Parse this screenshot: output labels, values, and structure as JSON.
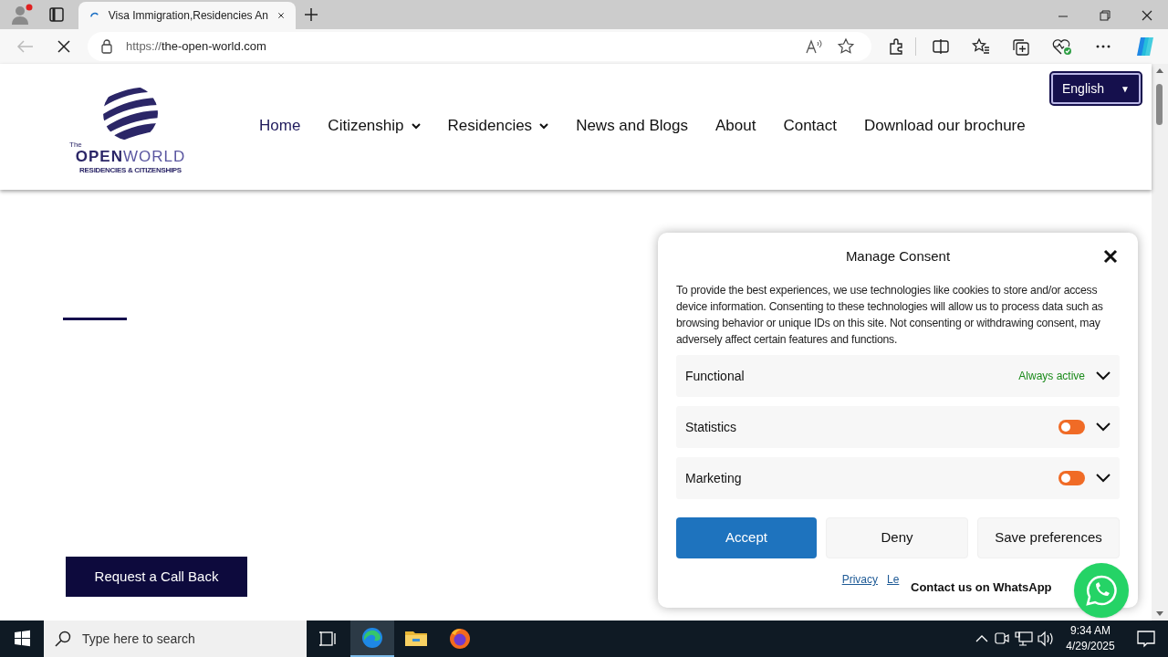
{
  "browser": {
    "tab": {
      "title": "Visa Immigration,Residencies An",
      "loading": true
    },
    "url_scheme": "https://",
    "url_host": "the-open-world.com"
  },
  "site": {
    "logo": {
      "small": "The",
      "name_bold": "OPEN",
      "name_light": "WORLD",
      "tagline": "RESIDENCIES & CITIZENSHIPS"
    },
    "nav": [
      {
        "label": "Home",
        "selected": true,
        "dropdown": false
      },
      {
        "label": "Citizenship",
        "selected": false,
        "dropdown": true
      },
      {
        "label": "Residencies",
        "selected": false,
        "dropdown": true
      },
      {
        "label": "News and Blogs",
        "selected": false,
        "dropdown": false
      },
      {
        "label": "About",
        "selected": false,
        "dropdown": false
      },
      {
        "label": "Contact",
        "selected": false,
        "dropdown": false
      },
      {
        "label": "Download our brochure",
        "selected": false,
        "dropdown": false
      }
    ],
    "language": "English",
    "language_caret": "▼",
    "callback_button": "Request a Call Back"
  },
  "consent": {
    "title": "Manage Consent",
    "text": "To provide the best experiences, we use technologies like cookies to store and/or access device information. Consenting to these technologies will allow us to process data such as browsing behavior or unique IDs on this site. Not consenting or withdrawing consent, may adversely affect certain features and functions.",
    "categories": [
      {
        "name": "Functional",
        "kind": "always",
        "status": "Always active"
      },
      {
        "name": "Statistics",
        "kind": "toggle",
        "on": false
      },
      {
        "name": "Marketing",
        "kind": "toggle",
        "on": false
      }
    ],
    "buttons": [
      {
        "label": "Accept",
        "primary": true
      },
      {
        "label": "Deny",
        "primary": false
      },
      {
        "label": "Save preferences",
        "primary": false
      }
    ],
    "links": [
      "Privacy",
      "Le"
    ]
  },
  "whatsapp": {
    "tooltip": "Contact us on WhatsApp"
  },
  "taskbar": {
    "search_placeholder": "Type here to search",
    "time": "9:34 AM",
    "date": "4/29/2025"
  }
}
